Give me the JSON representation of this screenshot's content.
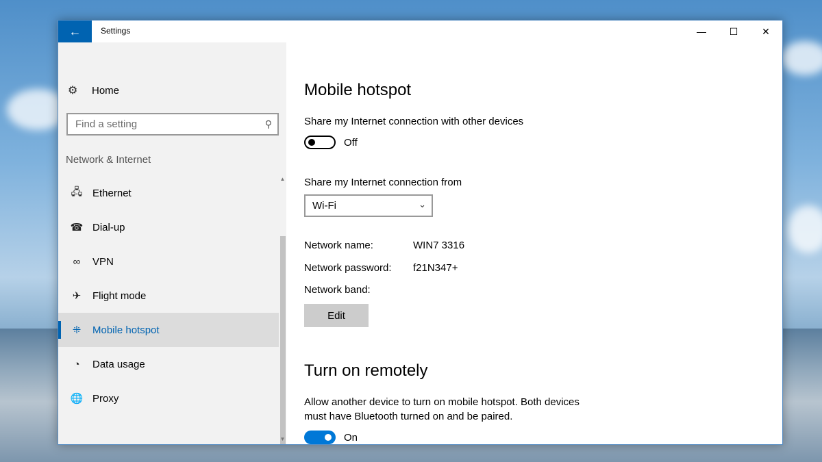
{
  "window": {
    "title": "Settings"
  },
  "icons": {
    "back": "back-arrow-icon",
    "minimize": "minimize-icon",
    "maximize": "maximize-icon",
    "close": "close-icon"
  },
  "sidebar": {
    "home_label": "Home",
    "search_placeholder": "Find a setting",
    "section_header": "Network & Internet",
    "items": [
      {
        "label": "Ethernet",
        "icon": "ethernet-icon"
      },
      {
        "label": "Dial-up",
        "icon": "dialup-icon"
      },
      {
        "label": "VPN",
        "icon": "vpn-icon"
      },
      {
        "label": "Flight mode",
        "icon": "airplane-icon"
      },
      {
        "label": "Mobile hotspot",
        "icon": "hotspot-icon",
        "active": true
      },
      {
        "label": "Data usage",
        "icon": "data-usage-icon"
      },
      {
        "label": "Proxy",
        "icon": "globe-icon"
      }
    ]
  },
  "main": {
    "title": "Mobile hotspot",
    "share_label": "Share my Internet connection with other devices",
    "share_state": "Off",
    "share_from_label": "Share my Internet connection from",
    "share_from_value": "Wi-Fi",
    "network_name_label": "Network name:",
    "network_name_value": "WIN7 3316",
    "network_password_label": "Network password:",
    "network_password_value": "f21N347+",
    "network_band_label": "Network band:",
    "edit_label": "Edit",
    "remote_title": "Turn on remotely",
    "remote_desc_line1": "Allow another device to turn on mobile hotspot. Both devices",
    "remote_desc_line2": "must have Bluetooth turned on and be paired.",
    "remote_state": "On"
  },
  "colors": {
    "accent": "#0063b1",
    "toggle_on": "#0078d7"
  }
}
